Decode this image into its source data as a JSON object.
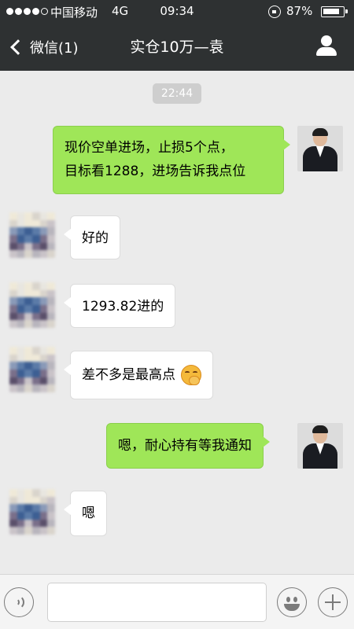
{
  "status_bar": {
    "carrier": "中国移动",
    "network": "4G",
    "time": "09:34",
    "battery": "87%",
    "battery_level": 0.87
  },
  "nav": {
    "back_label": "微信(1)",
    "title": "实仓10万—袁"
  },
  "chat": {
    "timestamp": "22:44",
    "messages": [
      {
        "sender": "me",
        "text": "现价空单进场，止损5个点，",
        "text2": "目标看1288，进场告诉我点位"
      },
      {
        "sender": "other",
        "text": "好的"
      },
      {
        "sender": "other",
        "text": "1293.82进的"
      },
      {
        "sender": "other",
        "text": "差不多是最高点",
        "emoji": "hand-over-mouth-emoji"
      },
      {
        "sender": "me",
        "text": "嗯，耐心持有等我通知"
      },
      {
        "sender": "other",
        "text": "嗯"
      }
    ]
  },
  "input_bar": {
    "input_value": "",
    "voice_icon": "voice-icon",
    "emoji_icon": "smiley-icon",
    "plus_icon": "plus-icon"
  },
  "colors": {
    "nav_bg": "#2e3132",
    "chat_bg": "#ebebeb",
    "my_bubble": "#9fe658",
    "other_bubble": "#ffffff"
  }
}
